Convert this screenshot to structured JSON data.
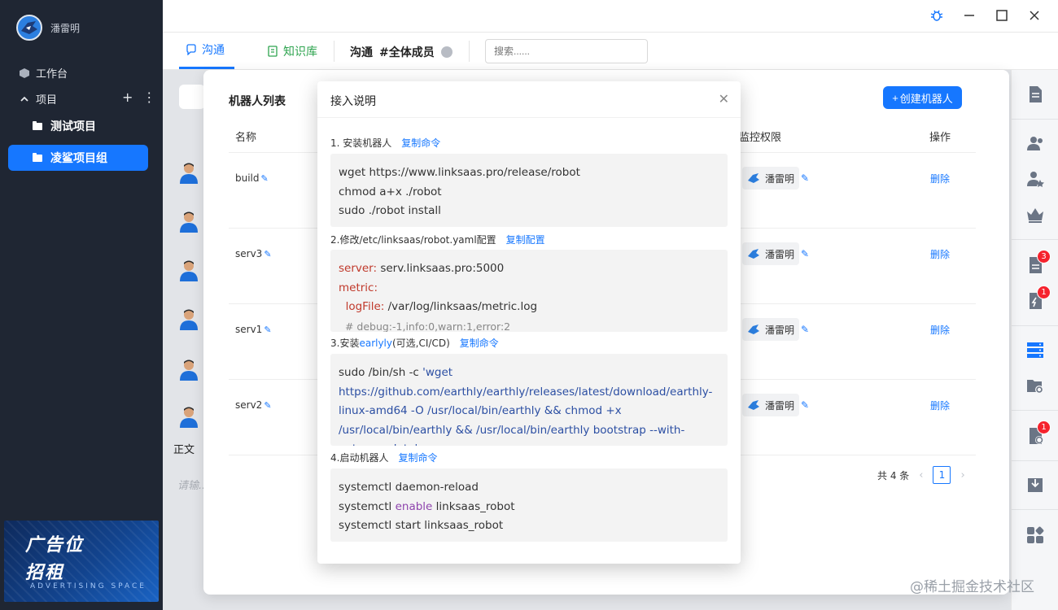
{
  "sidebar": {
    "user_name": "潘雷明",
    "workbench": "工作台",
    "projects_label": "项目",
    "projects": [
      {
        "label": "测试项目",
        "active": false
      },
      {
        "label": "凌鲨项目组",
        "active": true
      }
    ],
    "ad": {
      "line1": "广告位",
      "line2": "招租",
      "line3": "ADVERTISING SPACE"
    }
  },
  "tabs": {
    "comm": "沟通",
    "kb": "知识库",
    "channel_title_prefix": "沟通",
    "channel_title": "#全体成员",
    "search_placeholder": "搜索......"
  },
  "background": {
    "editor_label": "正文",
    "editor_placeholder": "请输..."
  },
  "robot_list": {
    "title": "机器人列表",
    "create_button": "创建机器人",
    "columns": {
      "name": "名称",
      "monitor": "监控权限",
      "action": "操作"
    },
    "rows": [
      {
        "name": "build",
        "monitor_user": "潘雷明",
        "action": "删除"
      },
      {
        "name": "serv3",
        "monitor_user": "潘雷明",
        "action": "删除"
      },
      {
        "name": "serv1",
        "monitor_user": "潘雷明",
        "action": "删除"
      },
      {
        "name": "serv2",
        "monitor_user": "潘雷明",
        "action": "删除"
      }
    ],
    "pager": {
      "total": "共 4 条",
      "page": "1"
    }
  },
  "modal": {
    "title": "接入说明",
    "step1": {
      "label": "1. 安装机器人",
      "link": "复制命令"
    },
    "code1": [
      "wget https://www.linksaas.pro/release/robot",
      "chmod a+x ./robot",
      "sudo ./robot install"
    ],
    "step2": {
      "label": "2.修改/etc/linksaas/robot.yaml配置",
      "link": "复制配置"
    },
    "code2": {
      "server_key": "server:",
      "server_val": " serv.linksaas.pro:5000",
      "metric_key": "metric:",
      "logfile_key": "  logFile:",
      "logfile_val": " /var/log/linksaas/metric.log",
      "comment": "  # debug:-1,info:0,warn:1,error:2"
    },
    "step3": {
      "pre": "3.安装",
      "hl": "earlyly",
      "post": "(可选,CI/CD)",
      "link": "复制命令"
    },
    "code3": {
      "prefix": "sudo /bin/sh -c ",
      "quoted": "'wget https://github.com/earthly/earthly/releases/latest/download/earthly-linux-amd64 -O /usr/local/bin/earthly && chmod +x /usr/local/bin/earthly && /usr/local/bin/earthly bootstrap --with-autocomplete'"
    },
    "step4": {
      "label": "4.启动机器人",
      "link": "复制命令"
    },
    "code4": {
      "l1": "systemctl daemon-reload",
      "l2_pre": "systemctl ",
      "l2_kw": "enable",
      "l2_post": " linksaas_robot",
      "l3": "systemctl start linksaas_robot"
    }
  },
  "badges": {
    "b1": "3",
    "b2": "1",
    "b3": "1"
  },
  "watermark": "@稀土掘金技术社区",
  "colors": {
    "accent": "#1677ff",
    "sidebar_bg": "#1f2633",
    "badge": "#f5222d"
  }
}
